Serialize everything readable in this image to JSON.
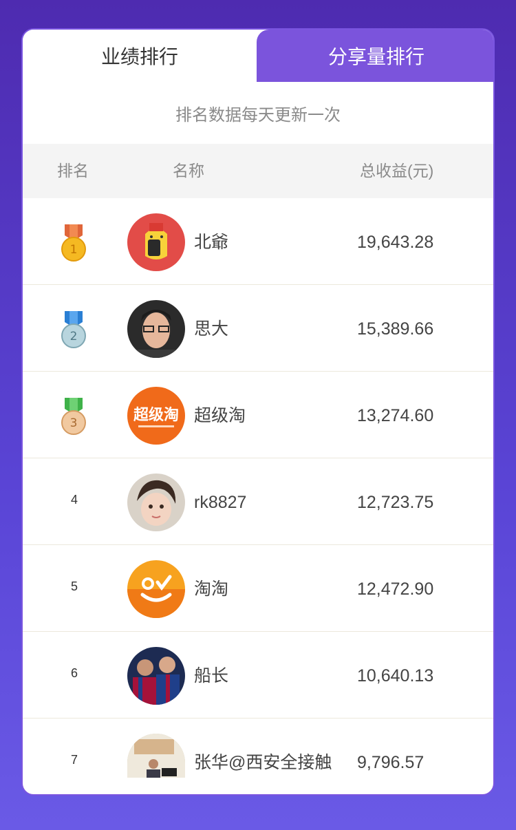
{
  "tabs": {
    "performance": "业绩排行",
    "shares": "分享量排行"
  },
  "notice": "排名数据每天更新一次",
  "table_header": {
    "rank": "排名",
    "name": "名称",
    "income": "总收益(元)"
  },
  "rows": [
    {
      "rank": "1",
      "name": "北爺",
      "income": "19,643.28",
      "medal": "gold"
    },
    {
      "rank": "2",
      "name": "思大",
      "income": "15,389.66",
      "medal": "silver"
    },
    {
      "rank": "3",
      "name": "超级淘",
      "income": "13,274.60",
      "medal": "bronze",
      "avatar_text": "超级淘"
    },
    {
      "rank": "4",
      "name": "rk8827",
      "income": "12,723.75"
    },
    {
      "rank": "5",
      "name": "淘淘",
      "income": "12,472.90"
    },
    {
      "rank": "6",
      "name": "船长",
      "income": "10,640.13"
    },
    {
      "rank": "7",
      "name": "张华@西安全接触",
      "income": "9,796.57"
    }
  ]
}
